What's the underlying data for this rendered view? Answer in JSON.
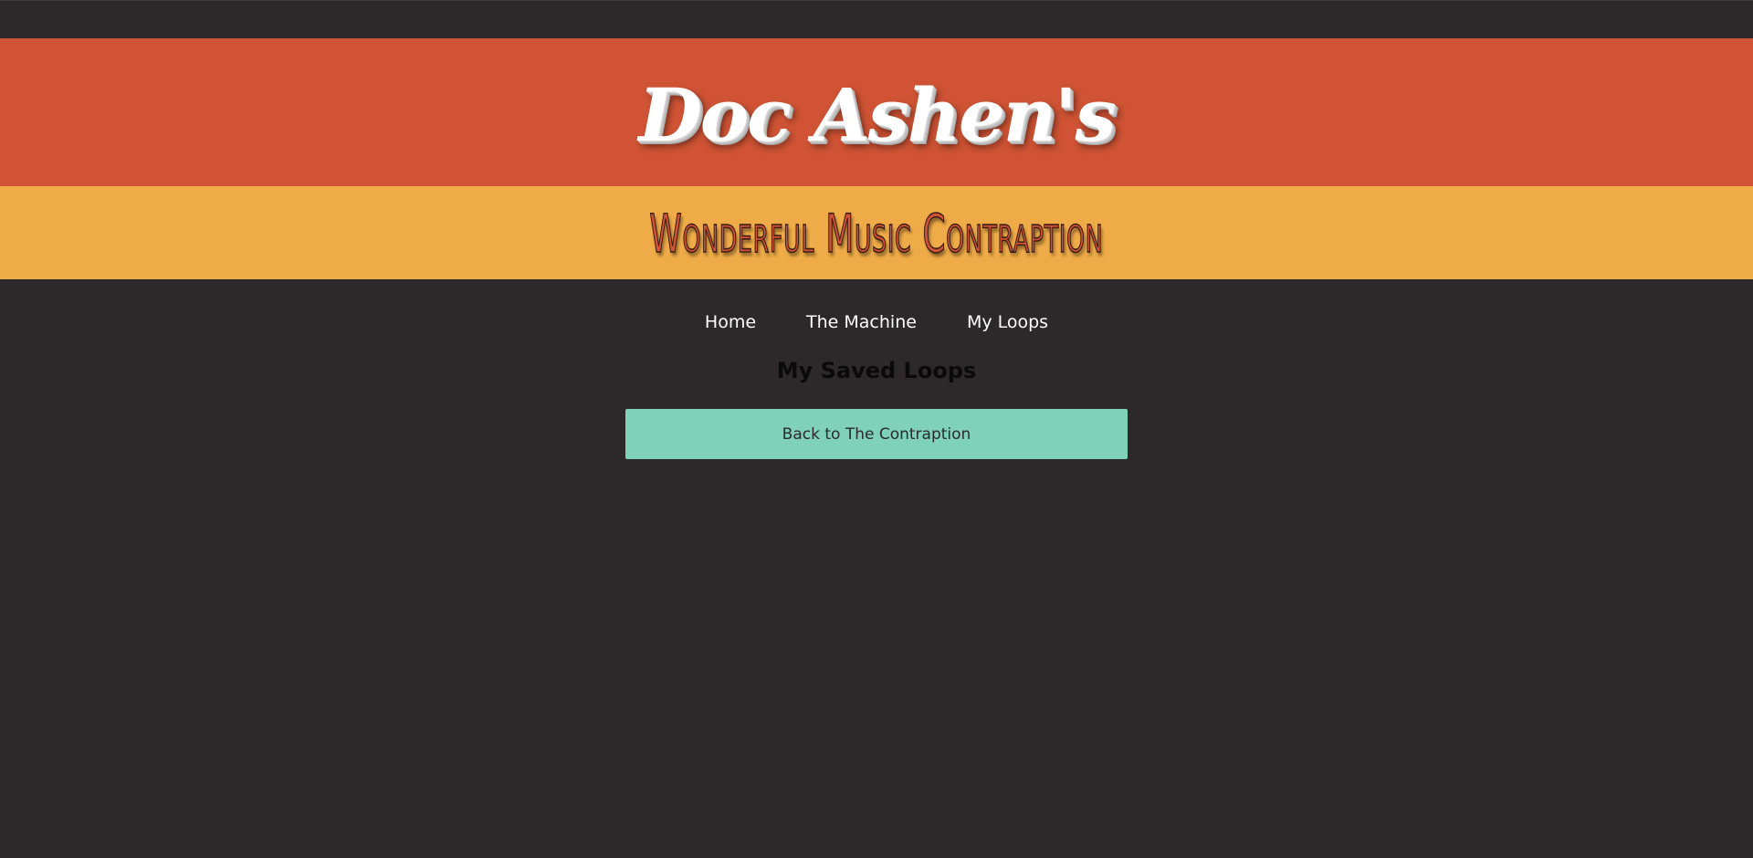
{
  "header": {
    "title": "Doc Ashen's",
    "subtitle": "Wonderful Music Contraption"
  },
  "nav": {
    "items": [
      {
        "label": "Home"
      },
      {
        "label": "The Machine"
      },
      {
        "label": "My Loops"
      }
    ]
  },
  "main": {
    "heading": "My Saved Loops",
    "back_button_label": "Back to The Contraption"
  },
  "colors": {
    "background": "#2d282a",
    "title_band": "#cf5334",
    "subtitle_band": "#eeab47",
    "button": "#7fd1b7"
  }
}
